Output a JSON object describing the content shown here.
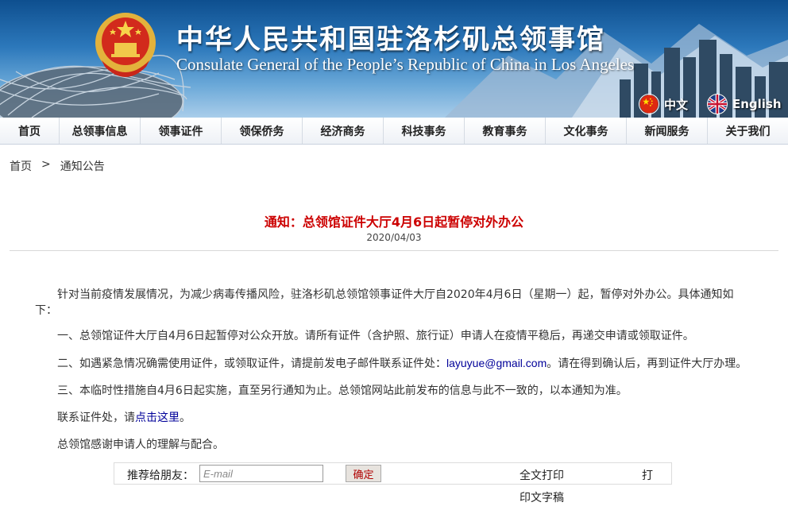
{
  "banner": {
    "title_cn": "中华人民共和国驻洛杉矶总领事馆",
    "title_en": "Consulate General of the People’s Republic of China in Los  Angeles",
    "lang_cn": "中文",
    "lang_en": "English"
  },
  "nav": {
    "items": [
      "首页",
      "总领事信息",
      "领事证件",
      "领保侨务",
      "经济商务",
      "科技事务",
      "教育事务",
      "文化事务",
      "新闻服务",
      "关于我们"
    ]
  },
  "breadcrumb": {
    "home": "首页",
    "separator": ">",
    "current": "通知公告"
  },
  "article": {
    "title": "通知：总领馆证件大厅4月6日起暂停对外办公",
    "date": "2020/04/03",
    "intro": "针对当前疫情发展情况，为减少病毒传播风险，驻洛杉矶总领馆领事证件大厅自2020年4月6日（星期一）起，暂停对外办公。具体通知如下：",
    "p1": "一、总领馆证件大厅自4月6日起暂停对公众开放。请所有证件（含护照、旅行证）申请人在疫情平稳后，再递交申请或领取证件。",
    "p2_pre": "二、如遇紧急情况确需使用证件，或领取证件，请提前发电子邮件联系证件处：",
    "p2_email": "layuyue@gmail.com",
    "p2_post": "。请在得到确认后，再到证件大厅办理。",
    "p3": "三、本临时性措施自4月6日起实施，直至另行通知为止。总领馆网站此前发布的信息与此不一致的，以本通知为准。",
    "contact_pre": "联系证件处，请",
    "contact_link": "点击这里",
    "contact_post": "。",
    "thanks": "总领馆感谢申请人的理解与配合。"
  },
  "share": {
    "label": "推荐给朋友：",
    "email_placeholder": "E-mail",
    "confirm": "确定",
    "print_full": "全文打印",
    "print_full_2": "打",
    "print_text": "印文字稿"
  },
  "colors": {
    "title_red": "#cc0000",
    "link_blue": "#000099",
    "banner_blue": "#2c78bb"
  }
}
